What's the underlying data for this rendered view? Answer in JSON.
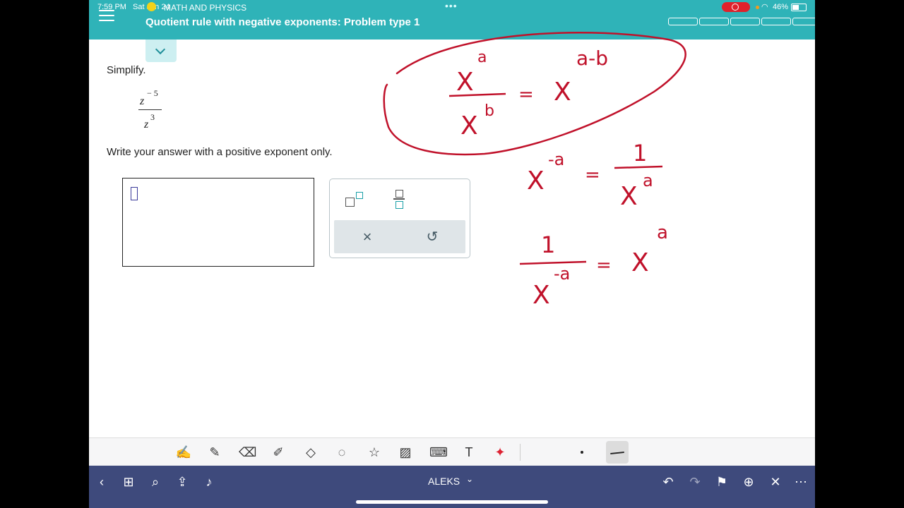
{
  "status_bar": {
    "time": "7:59 PM",
    "date": "Sat Jun 24",
    "battery": "46%",
    "dots": "•••"
  },
  "header": {
    "subject": "MATH AND PHYSICS",
    "title": "Quotient rule with negative exponents: Problem type 1",
    "color": "#2fb3b8"
  },
  "problem": {
    "prompt": "Simplify.",
    "numerator_base": "z",
    "numerator_exponent": "− 5",
    "denominator_base": "z",
    "denominator_exponent": "3",
    "instruction": "Write your answer with a positive exponent only."
  },
  "keypad": {
    "clear_symbol": "×",
    "undo_symbol": "↺"
  },
  "annotations": {
    "rule1": {
      "num": "X",
      "num_exp": "a",
      "den": "X",
      "den_exp": "b",
      "eq": "=",
      "rhs": "X",
      "rhs_exp": "a-b"
    },
    "rule2": {
      "lhs": "X",
      "lhs_exp": "-a",
      "eq": "=",
      "num": "1",
      "den": "X",
      "den_exp": "a"
    },
    "rule3": {
      "num": "1",
      "den": "X",
      "den_exp": "-a",
      "eq": "=",
      "rhs": "X",
      "rhs_exp": "a"
    },
    "ink_color": "#c0112a"
  },
  "toolbar": {
    "tools": [
      "handwriting-icon",
      "pen-icon",
      "eraser-icon",
      "highlighter-icon",
      "shapes-icon",
      "lasso-icon",
      "sticker-icon",
      "image-icon",
      "keyboard-icon",
      "text-icon",
      "laser-icon"
    ]
  },
  "bottom_bar": {
    "app_name": "ALEKS",
    "caret": "⌄",
    "color": "#3e4a7c"
  }
}
